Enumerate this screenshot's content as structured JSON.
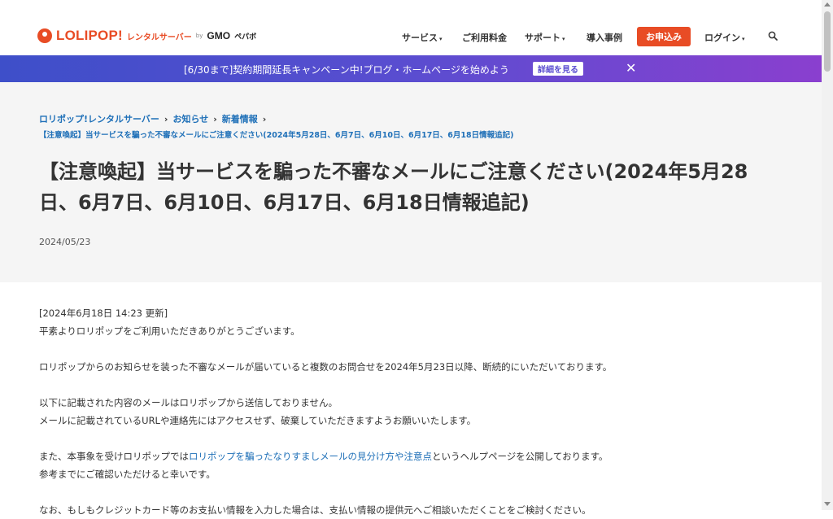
{
  "header": {
    "logo_text": "LOLIPOP!",
    "logo_sub": "レンタルサーバー",
    "logo_by": "by",
    "logo_gmo": "GMO",
    "logo_gmo_sub": "ペパボ",
    "nav": [
      {
        "label": "サービス",
        "has_caret": true
      },
      {
        "label": "ご利用料金",
        "has_caret": false
      },
      {
        "label": "サポート",
        "has_caret": true
      },
      {
        "label": "導入事例",
        "has_caret": false
      },
      {
        "label": "ログイン",
        "has_caret": true
      }
    ],
    "apply_label": "お申込み",
    "caret": "▾",
    "search_icon": "search-icon"
  },
  "banner": {
    "text": "[6/30まで]契約期間延長キャンペーン中!ブログ・ホームページを始めよう",
    "button_label": "詳細を見る",
    "close": "✕"
  },
  "breadcrumb": {
    "items": [
      "ロリポップ!レンタルサーバー",
      "お知らせ",
      "新着情報"
    ],
    "current": "【注意喚起】当サービスを騙った不審なメールにご注意ください(2024年5月28日、6月7日、6月10日、6月17日、6月18日情報追記)",
    "separator": "›"
  },
  "article": {
    "title": "【注意喚起】当サービスを騙った不審なメールにご注意ください(2024年5月28日、6月7日、6月10日、6月17日、6月18日情報追記)",
    "date": "2024/05/23",
    "update_note": "[2024年6月18日 14:23 更新]",
    "p1": "平素よりロリポップをご利用いただきありがとうございます。",
    "p2": "ロリポップからのお知らせを装った不審なメールが届いていると複数のお問合せを2024年5月23日以降、断続的にいただいております。",
    "p3a": "以下に記載された内容のメールはロリポップから送信しておりません。",
    "p3b": "メールに記載されているURLや連絡先にはアクセスせず、破棄していただきますようお願いいたします。",
    "p4_pre": "また、本事象を受けロリポップでは",
    "p4_link": "ロリポップを騙ったなりすましメールの見分け方や注意点",
    "p4_post": "というヘルプページを公開しております。",
    "p4b": "参考までにご確認いただけると幸いです。",
    "p5": "なお、もしもクレジットカード等のお支払い情報を入力した場合は、支払い情報の提供元へご相談いただくことをご検討ください。"
  }
}
